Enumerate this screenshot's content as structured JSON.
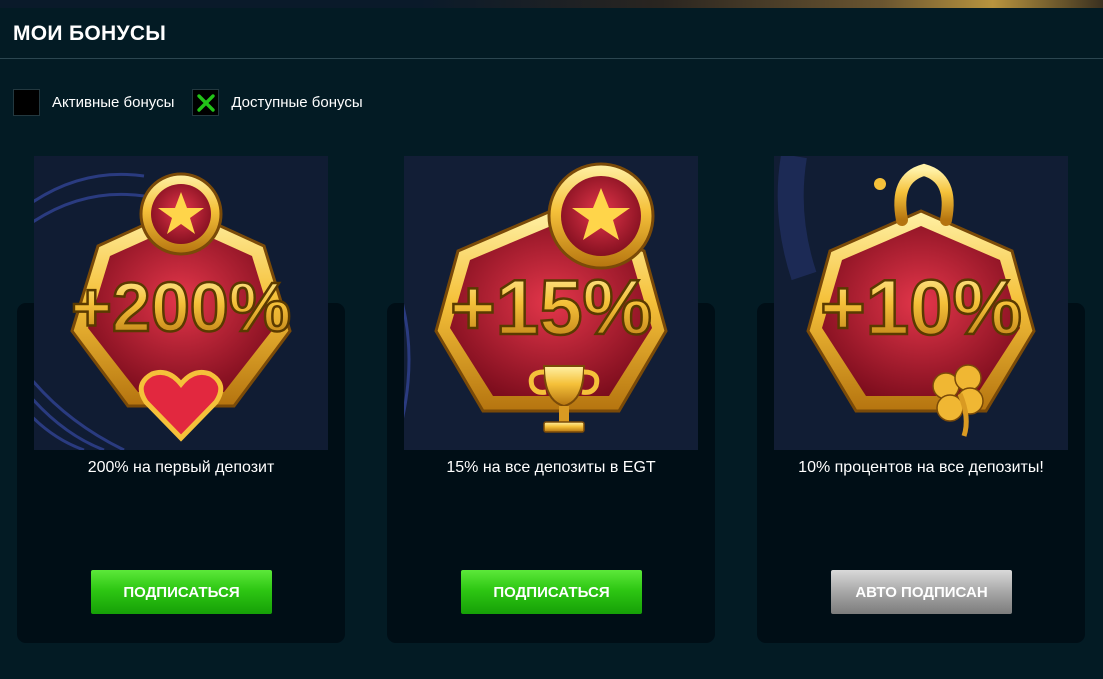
{
  "page": {
    "title": "МОИ БОНУСЫ"
  },
  "filters": [
    {
      "label": "Активные бонусы",
      "checked": false
    },
    {
      "label": "Доступные бонусы",
      "checked": true,
      "check_color": "#22c318",
      "check_icon": "x-mark-icon"
    }
  ],
  "bonuses": [
    {
      "image_text": "+200%",
      "image_icons": [
        "star-icon",
        "heart-gem-icon"
      ],
      "description": "200% на первый депозит",
      "button_label": "ПОДПИСАТЬСЯ",
      "button_state": "subscribe"
    },
    {
      "image_text": "+15%",
      "image_icons": [
        "star-coin-icon",
        "trophy-icon"
      ],
      "description": "15% на все депозиты в EGT",
      "button_label": "ПОДПИСАТЬСЯ",
      "button_state": "subscribe"
    },
    {
      "image_text": "+10%",
      "image_icons": [
        "horseshoe-icon",
        "clover-icon"
      ],
      "description": "10% процентов на все депозиты!",
      "button_label": "АВТО ПОДПИСАН",
      "button_state": "auto-subscribed"
    }
  ],
  "colors": {
    "background": "#031b24",
    "card": "#000e16",
    "subscribe_button": "#2ec713",
    "auto_button": "#a7a7a7",
    "gold": "#f5c13a",
    "badge_red": "#b0162a"
  }
}
